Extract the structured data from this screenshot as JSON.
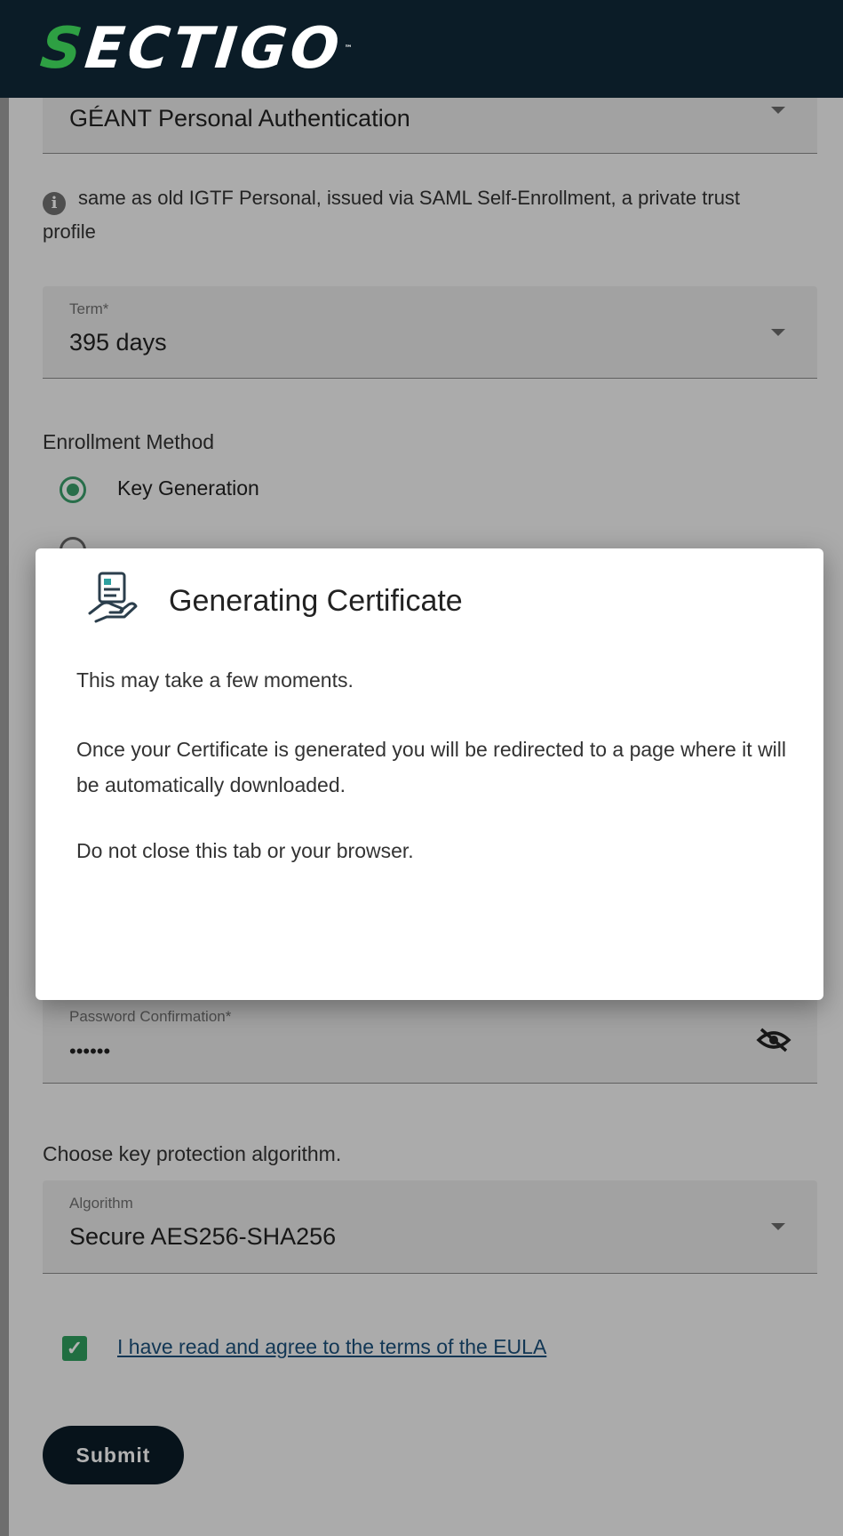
{
  "header": {
    "logo_first_letter": "S",
    "logo_rest": "ECTIGO",
    "logo_tm": "™"
  },
  "profile_field": {
    "value": "GÉANT Personal Authentication",
    "icon": "dropdown-caret"
  },
  "profile_info": {
    "icon": "info-icon",
    "text": "same as old IGTF Personal, issued via SAML Self-Enrollment, a private trust profile"
  },
  "term_field": {
    "label": "Term*",
    "value": "395 days",
    "icon": "dropdown-caret"
  },
  "enrollment": {
    "heading": "Enrollment Method",
    "options": [
      {
        "label": "Key Generation",
        "selected": true
      }
    ]
  },
  "password_confirmation": {
    "label": "Password Confirmation*",
    "value": "••••••",
    "icon": "eye-off-icon"
  },
  "algorithm": {
    "heading": "Choose key protection algorithm.",
    "label": "Algorithm",
    "value": "Secure AES256-SHA256",
    "icon": "dropdown-caret"
  },
  "eula": {
    "checked": true,
    "link_text": "I have read and agree to the terms of the EULA"
  },
  "submit": {
    "label": "Submit"
  },
  "dialog": {
    "icon": "certificate-hand-icon",
    "title": "Generating Certificate",
    "line1": "This may take a few moments.",
    "line2": "Once your Certificate is generated you will be redirected to a page where it will be automatically downloaded.",
    "line3": "Do not close this tab or your browser."
  },
  "colors": {
    "header_bg": "#0b1c27",
    "accent_green": "#2ea043",
    "radio_green": "#3a9e6a",
    "link_blue": "#1a4f7a"
  }
}
